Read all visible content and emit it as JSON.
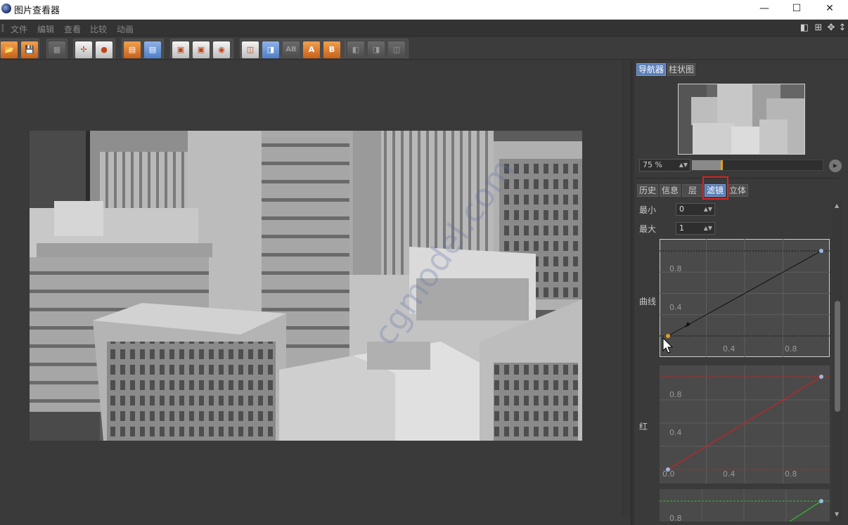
{
  "window": {
    "title": "图片查看器",
    "minimize": "—",
    "maximize": "☐",
    "close": "✕"
  },
  "menu": {
    "items": [
      "文件",
      "编辑",
      "查看",
      "比较",
      "动画"
    ]
  },
  "toolbar": {
    "ab_label": "AB",
    "a_label": "A",
    "b_label": "B"
  },
  "panel": {
    "top_tabs": [
      "导航器",
      "柱状图"
    ],
    "zoom": "75 %",
    "zoom_fraction": 0.22,
    "filter_tabs": [
      "历史",
      "信息",
      "层",
      "滤镜",
      "立体"
    ],
    "active_filter_tab": "滤镜",
    "min_label": "最小",
    "min_value": "0",
    "max_label": "最大",
    "max_value": "1",
    "curve_label": "曲线",
    "red_label": "红"
  },
  "chart_data": [
    {
      "type": "line",
      "name": "curve",
      "ytick_labels": [
        "0.8",
        "0.4"
      ],
      "xtick_labels": [
        "0.4",
        "0.8"
      ],
      "x": [
        0.0,
        1.0
      ],
      "y": [
        0.0,
        1.0
      ],
      "line_color": "#111111"
    },
    {
      "type": "line",
      "name": "red",
      "ytick_labels": [
        "0.8",
        "0.4"
      ],
      "xtick_labels": [
        "0.0",
        "0.4",
        "0.8"
      ],
      "x": [
        0.0,
        1.0
      ],
      "y": [
        0.0,
        1.0
      ],
      "line_color": "#d02020"
    },
    {
      "type": "line",
      "name": "green",
      "ytick_labels": [
        "0.8"
      ],
      "line_color": "#30c030"
    }
  ],
  "watermark": "cgmodel.com"
}
